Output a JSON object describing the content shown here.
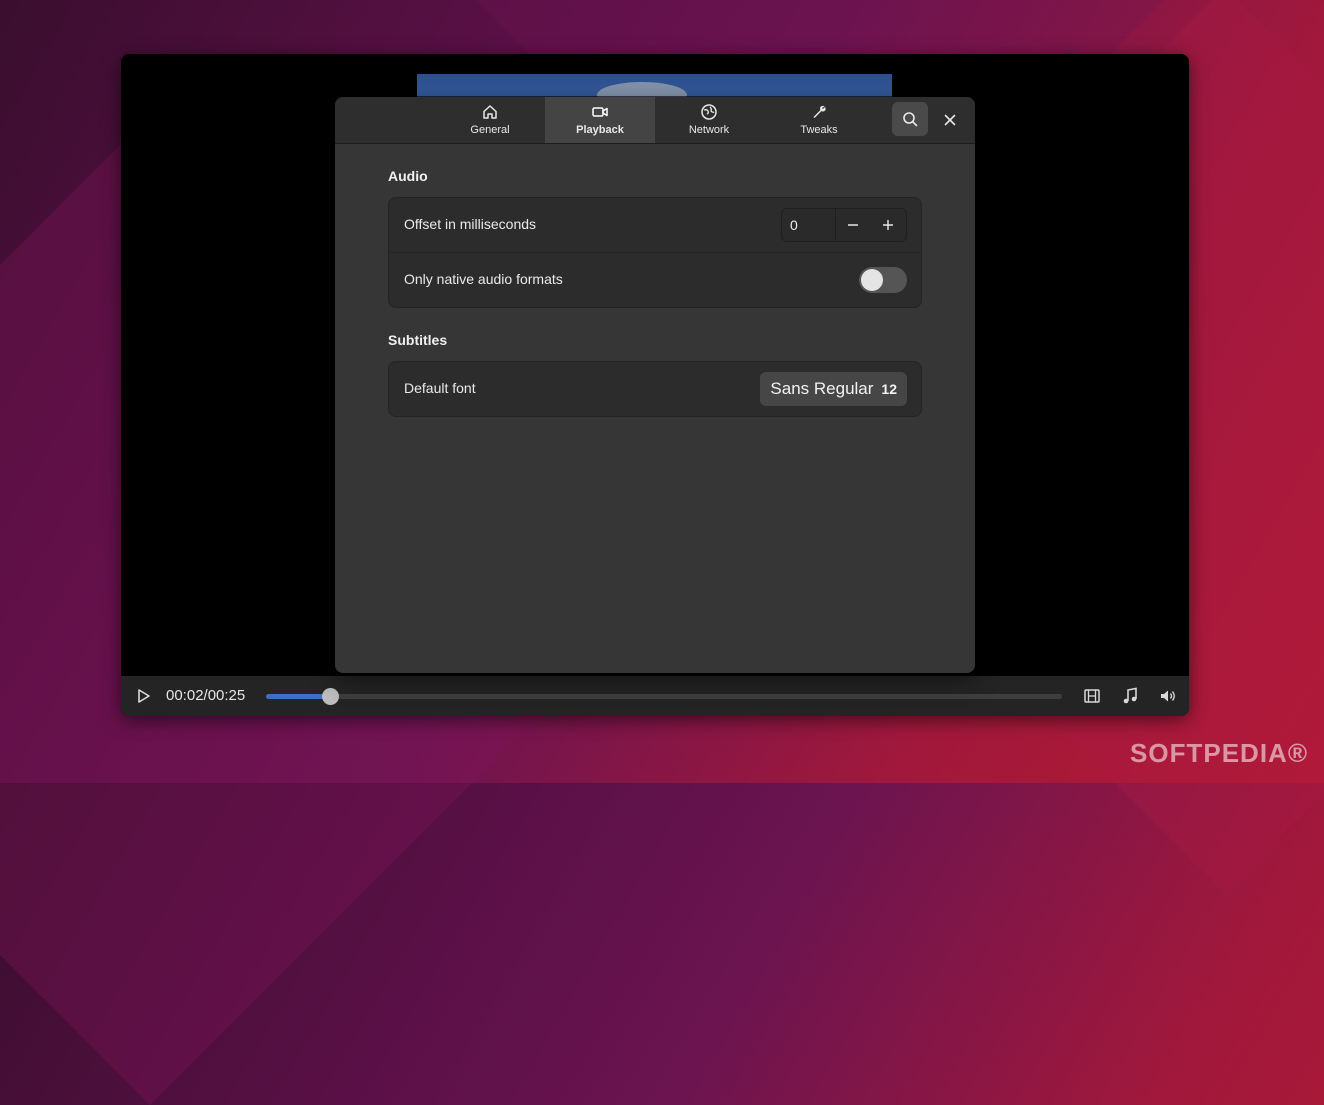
{
  "player": {
    "time": "00:02/00:25",
    "progress_fraction": 0.08
  },
  "dialog": {
    "tabs": [
      {
        "label": "General",
        "icon": "home-icon"
      },
      {
        "label": "Playback",
        "icon": "video-camera-icon",
        "active": true
      },
      {
        "label": "Network",
        "icon": "globe-icon"
      },
      {
        "label": "Tweaks",
        "icon": "wrench-icon"
      }
    ],
    "sections": {
      "audio": {
        "title": "Audio",
        "offset_label": "Offset in milliseconds",
        "offset_value": "0",
        "native_formats_label": "Only native audio formats",
        "native_formats_enabled": false
      },
      "subtitles": {
        "title": "Subtitles",
        "default_font_label": "Default font",
        "font_name": "Sans Regular",
        "font_size": "12"
      }
    }
  },
  "watermark": "SOFTPEDIA®",
  "colors": {
    "accent": "#3d6fc4",
    "dialog_bg": "#363636",
    "row_bg": "#2c2c2c"
  }
}
